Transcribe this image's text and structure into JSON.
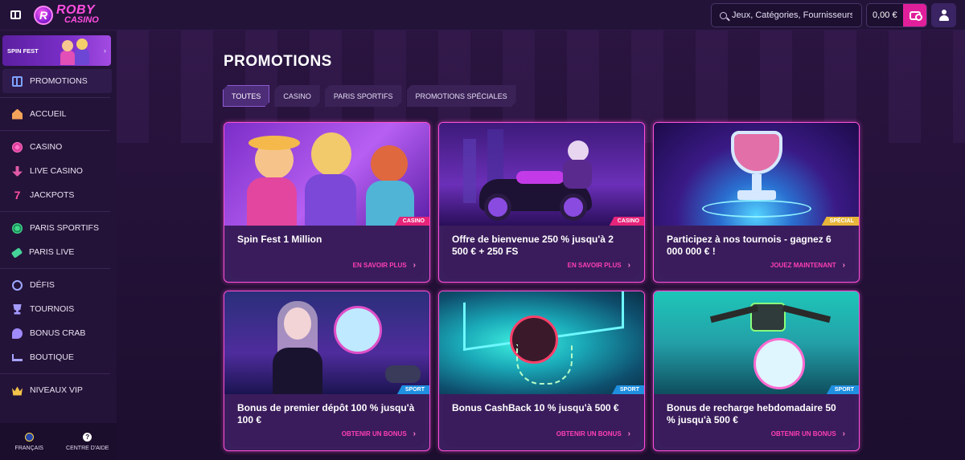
{
  "topbar": {
    "logo_line1": "ROBY",
    "logo_line2": "CASINO",
    "search_placeholder": "Jeux, Catégories, Fournisseurs",
    "balance": "0,00 €"
  },
  "sidebar": {
    "banner_label": "SPIN FEST",
    "items": [
      {
        "label": "PROMOTIONS",
        "icon": "gift-icon"
      },
      {
        "label": "ACCUEIL",
        "icon": "home-icon"
      },
      {
        "label": "CASINO",
        "icon": "casino-chip-icon"
      },
      {
        "label": "LIVE CASINO",
        "icon": "live-casino-icon"
      },
      {
        "label": "JACKPOTS",
        "icon": "seven-icon"
      },
      {
        "label": "PARIS SPORTIFS",
        "icon": "soccer-ball-icon"
      },
      {
        "label": "PARIS LIVE",
        "icon": "ticket-icon"
      },
      {
        "label": "DÉFIS",
        "icon": "medal-icon"
      },
      {
        "label": "TOURNOIS",
        "icon": "trophy-icon"
      },
      {
        "label": "BONUS CRAB",
        "icon": "crab-icon"
      },
      {
        "label": "BOUTIQUE",
        "icon": "cart-icon"
      },
      {
        "label": "NIVEAUX VIP",
        "icon": "crown-icon"
      }
    ],
    "footer": {
      "language": "FRANÇAIS",
      "help": "CENTRE D'AIDE"
    }
  },
  "main": {
    "title": "PROMOTIONS",
    "tabs": [
      "TOUTES",
      "CASINO",
      "PARIS SPORTIFS",
      "PROMOTIONS SPÉCIALES"
    ],
    "active_tab": "TOUTES",
    "cards": [
      {
        "title": "Spin Fest 1 Million",
        "cta": "EN SAVOIR PLUS",
        "badge": "CASINO",
        "badge_color": "#e6247a"
      },
      {
        "title": "Offre de bienvenue 250 % jusqu'à 2 500 € + 250 FS",
        "cta": "EN SAVOIR PLUS",
        "badge": "CASINO",
        "badge_color": "#e6247a"
      },
      {
        "title": "Participez à nos tournois - gagnez 6 000 000 € !",
        "cta": "JOUEZ MAINTENANT",
        "badge": "SPÉCIAL",
        "badge_color": "#e7b63a"
      },
      {
        "title": "Bonus de premier dépôt 100 % jusqu'à 100 €",
        "cta": "OBTENIR UN BONUS",
        "badge": "SPORT",
        "badge_color": "#1f8fe0"
      },
      {
        "title": "Bonus CashBack 10 % jusqu'à 500 €",
        "cta": "OBTENIR UN BONUS",
        "badge": "SPORT",
        "badge_color": "#1f8fe0"
      },
      {
        "title": "Bonus de recharge hebdomadaire 50 % jusqu'à 500 €",
        "cta": "OBTENIR UN BONUS",
        "badge": "SPORT",
        "badge_color": "#1f8fe0"
      }
    ]
  },
  "colors": {
    "accent": "#e11f9b",
    "card_border": "#ff4fd8",
    "cta": "#ff3fb4"
  }
}
